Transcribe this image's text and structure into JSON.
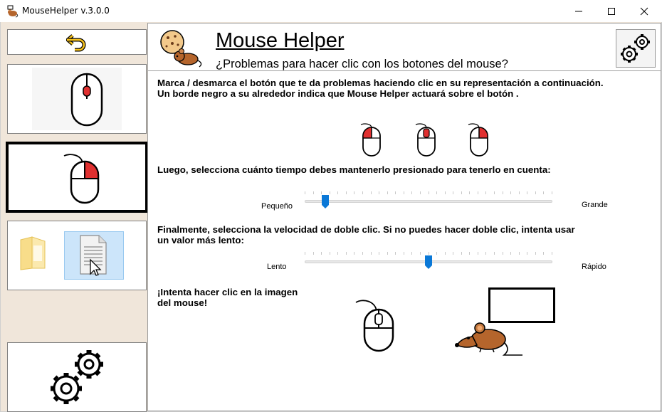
{
  "window": {
    "title": "MouseHelper v.3.0.0",
    "controls": {
      "minimize": "minimize-icon",
      "maximize": "maximize-icon",
      "close": "close-icon"
    }
  },
  "sidebar": {
    "items": [
      {
        "name": "back",
        "icon": "undo-arrow-icon"
      },
      {
        "name": "mouse-single-click",
        "icon": "mouse-icon"
      },
      {
        "name": "mouse-right-click",
        "icon": "mouse-icon",
        "selected": true
      },
      {
        "name": "drag-files",
        "icon": "document-cursor-icon"
      },
      {
        "name": "settings",
        "icon": "gears-icon"
      }
    ]
  },
  "header": {
    "title": "Mouse Helper",
    "subtitle": "¿Problemas para hacer clic con los botones del mouse?"
  },
  "instructions": {
    "line1": "Marca / desmarca el botón que te da problemas haciendo clic en su representación a continuación.",
    "line2": "Un borde negro a su alrededor indica que Mouse Helper actuará sobre el botón ."
  },
  "hold": {
    "text": "Luego, selecciona cuánto tiempo debes mantenerlo presionado para tenerlo en cuenta:",
    "min_label": "Pequeño",
    "max_label": "Grande",
    "value_fraction": 0.07
  },
  "double_click": {
    "line1": "Finalmente, selecciona la velocidad de doble clic. Si no puedes hacer doble clic, intenta usar",
    "line2": "un valor más lento:",
    "min_label": "Lento",
    "max_label": "Rápido",
    "value_fraction": 0.5
  },
  "test": {
    "line1": "¡Intenta hacer clic en la imagen",
    "line2": "del mouse!"
  },
  "colors": {
    "accent": "#0a78d7",
    "sidebar_bg": "#f0e6da",
    "mouse_red": "#e03030",
    "rat_brown": "#b5652c"
  }
}
